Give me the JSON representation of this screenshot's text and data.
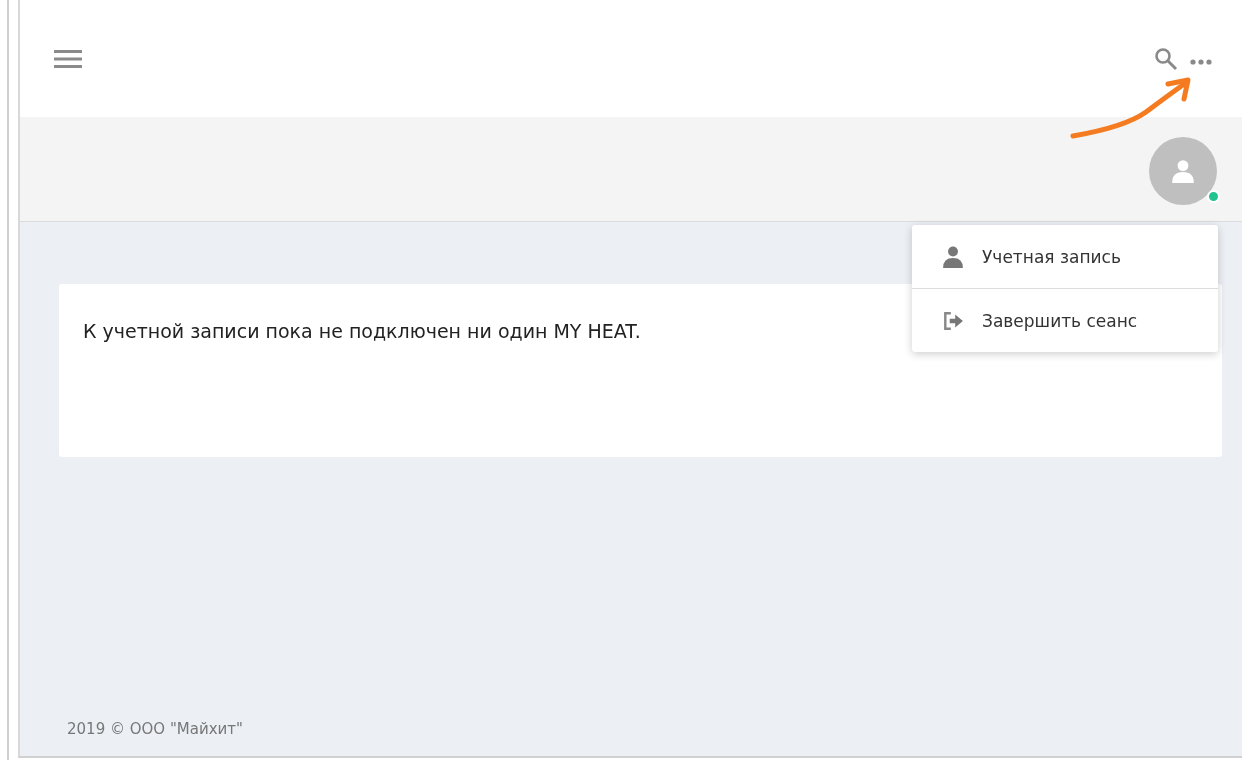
{
  "menu": [
    {
      "label": "Учетная запись",
      "kind": "account"
    },
    {
      "label": "Завершить сеанс",
      "kind": "logout"
    }
  ],
  "user": {
    "online": true
  },
  "message": "К учетной записи пока не подключен ни один MY HEAT.",
  "footer": "2019 © ООО \"Майхит\""
}
